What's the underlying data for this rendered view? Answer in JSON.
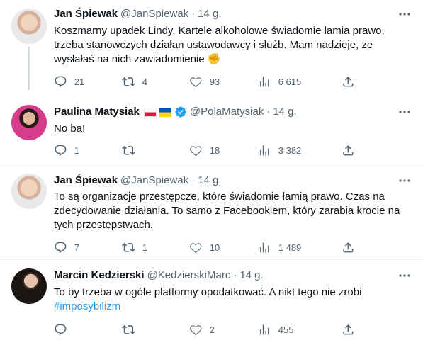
{
  "tweets": [
    {
      "name": "Jan Śpiewak",
      "handle": "@JanSpiewak",
      "dot": "·",
      "time": "14 g.",
      "lines": [
        "Koszmarny upadek Lindy. Kartele alkoholowe świadomie lamia prawo,",
        "trzeba stanowczych działan ustawodawcy i służb. Mam nadzieje, ze",
        "wysłałaś na nich zawiadomienie ✊"
      ],
      "replies": "21",
      "retweets": "4",
      "likes": "93",
      "views": "6 615"
    },
    {
      "name": "Paulina Matysiak",
      "handle": "@PolaMatysiak",
      "dot": "·",
      "time": "14 g.",
      "lines": [
        "No ba!"
      ],
      "replies": "1",
      "retweets": "",
      "likes": "18",
      "views": "3 382"
    },
    {
      "name": "Jan Śpiewak",
      "handle": "@JanSpiewak",
      "dot": "·",
      "time": "14 g.",
      "lines": [
        "To są organizacje przestępcze, które świadomie łamią prawo. Czas na",
        "zdecydowanie działania. To samo z Facebookiem, który zarabia krocie na",
        "tych przestępstwach."
      ],
      "replies": "7",
      "retweets": "1",
      "likes": "10",
      "views": "1 489"
    },
    {
      "name": "Marcin Kedzierski",
      "handle": "@KedzierskiMarc",
      "dot": "·",
      "time": "14 g.",
      "lines": [
        "To by trzeba w ogóle platformy opodatkować. A nikt tego nie zrobi"
      ],
      "hashtag": "#imposybilizm",
      "replies": "",
      "retweets": "",
      "likes": "2",
      "views": "455"
    }
  ],
  "colors": {
    "text": "#0f1419",
    "secondary": "#536471",
    "link": "#1d9bf0",
    "verified": "#1d9bf0"
  },
  "icons": [
    "more-icon",
    "reply-icon",
    "retweet-icon",
    "like-icon",
    "views-icon",
    "share-icon",
    "verified-badge-icon",
    "flag-poland-icon",
    "flag-ukraine-icon"
  ]
}
